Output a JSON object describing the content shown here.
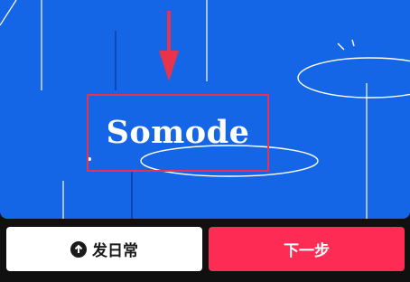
{
  "canvas": {
    "brand_text": "Somode",
    "background_color": "#1466e6"
  },
  "annotation": {
    "arrow_icon": "arrow-down-icon",
    "highlight_color": "#e8334a"
  },
  "buttons": {
    "daily": {
      "label": "发日常",
      "icon": "arrow-up-circle-icon"
    },
    "next": {
      "label": "下一步",
      "color": "#fe2c55"
    }
  }
}
